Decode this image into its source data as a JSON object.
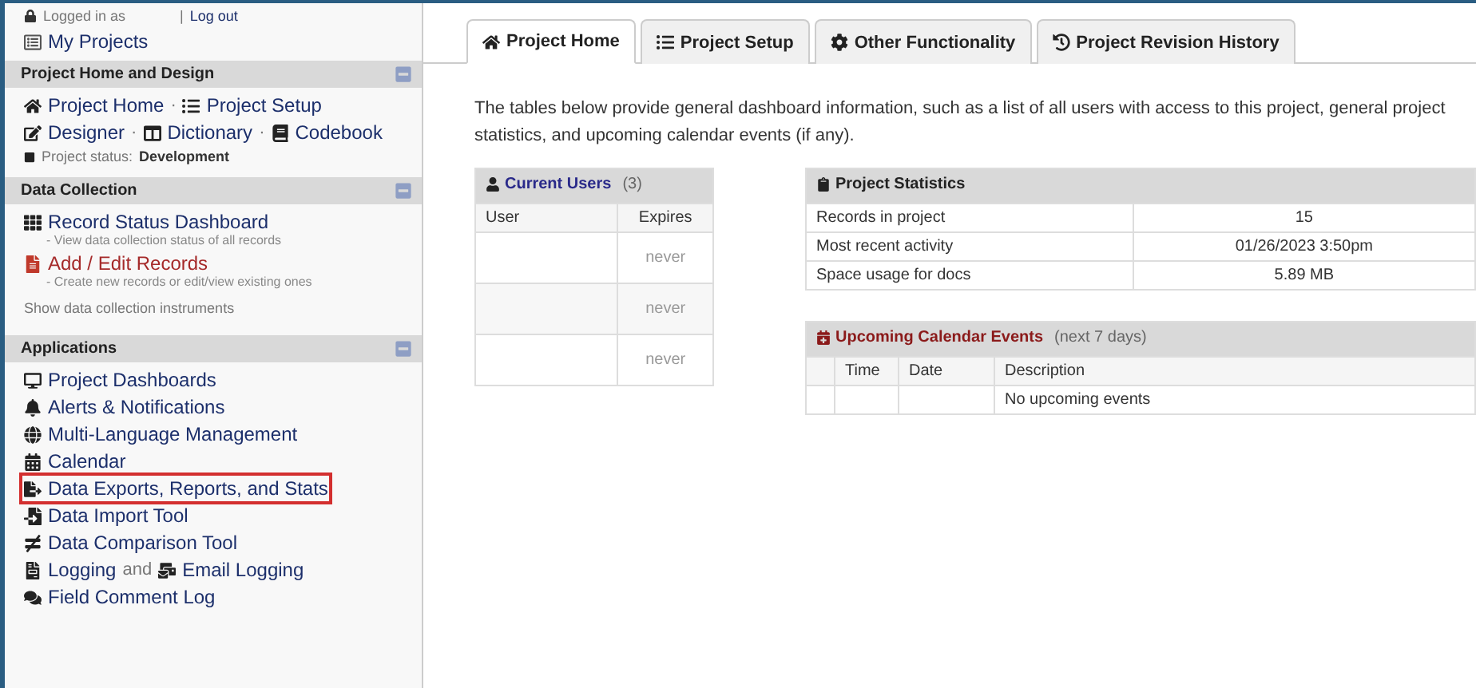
{
  "session": {
    "logged_in": "Logged in as",
    "logout": "Log out",
    "separator": "|"
  },
  "my_projects": "My Projects",
  "sections": [
    {
      "title": "Project Home and Design",
      "expanded": true,
      "items": [
        {
          "kind": "row",
          "separator": "·",
          "links": [
            "Project Home",
            "Project Setup"
          ]
        },
        {
          "kind": "row",
          "separator": "·",
          "links": [
            "Designer",
            "Dictionary",
            "Codebook"
          ]
        },
        {
          "kind": "status",
          "label": "Project status:",
          "value": "Development"
        }
      ]
    },
    {
      "title": "Data Collection",
      "expanded": true,
      "items": [
        {
          "kind": "link",
          "label": "Record Status Dashboard",
          "note": "- View data collection status of all records",
          "highlighted": false
        },
        {
          "kind": "alert-link",
          "label": "Add / Edit Records",
          "note": "- Create new records or edit/view existing ones",
          "highlighted": false
        },
        {
          "kind": "toggle",
          "label": "Show data collection instruments"
        }
      ]
    },
    {
      "title": "Applications",
      "expanded": true,
      "items": [
        {
          "kind": "link",
          "label": "Project Dashboards",
          "highlighted": false
        },
        {
          "kind": "link",
          "label": "Alerts & Notifications",
          "highlighted": false
        },
        {
          "kind": "link",
          "label": "Multi-Language Management",
          "highlighted": false
        },
        {
          "kind": "link",
          "label": "Calendar",
          "highlighted": false
        },
        {
          "kind": "link",
          "label": "Data Exports, Reports, and Stats",
          "highlighted": true
        },
        {
          "kind": "link",
          "label": "Data Import Tool",
          "highlighted": false
        },
        {
          "kind": "link",
          "label": "Data Comparison Tool",
          "highlighted": false
        },
        {
          "kind": "row",
          "separator": "and",
          "links": [
            "Logging",
            "Email Logging"
          ]
        },
        {
          "kind": "link",
          "label": "Field Comment Log",
          "highlighted": false
        }
      ]
    }
  ],
  "tabs": [
    {
      "label": "Project Home",
      "selected": true
    },
    {
      "label": "Project Setup",
      "selected": false
    },
    {
      "label": "Other Functionality",
      "selected": false
    },
    {
      "label": "Project Revision History",
      "selected": false
    }
  ],
  "intro": "The tables below provide general dashboard information, such as a list of all users with access to this project, general project statistics, and upcoming calendar events (if any).",
  "users": {
    "title": "Current Users",
    "count": "(3)",
    "columns": [
      "User",
      "Expires"
    ],
    "rows": [
      [
        "",
        "never"
      ],
      [
        "",
        "never"
      ],
      [
        "",
        "never"
      ]
    ]
  },
  "stats": {
    "title": "Project Statistics",
    "rows": [
      [
        "Records in project",
        "15"
      ],
      [
        "Most recent activity",
        "01/26/2023 3:50pm"
      ],
      [
        "Space usage for docs",
        "5.89 MB"
      ]
    ]
  },
  "calendar": {
    "title": "Upcoming Calendar Events",
    "subtitle": "(next 7 days)",
    "columns": [
      "",
      "Time",
      "Date",
      "Description"
    ],
    "rows": [
      [
        "",
        "",
        "",
        "No upcoming events"
      ]
    ]
  }
}
